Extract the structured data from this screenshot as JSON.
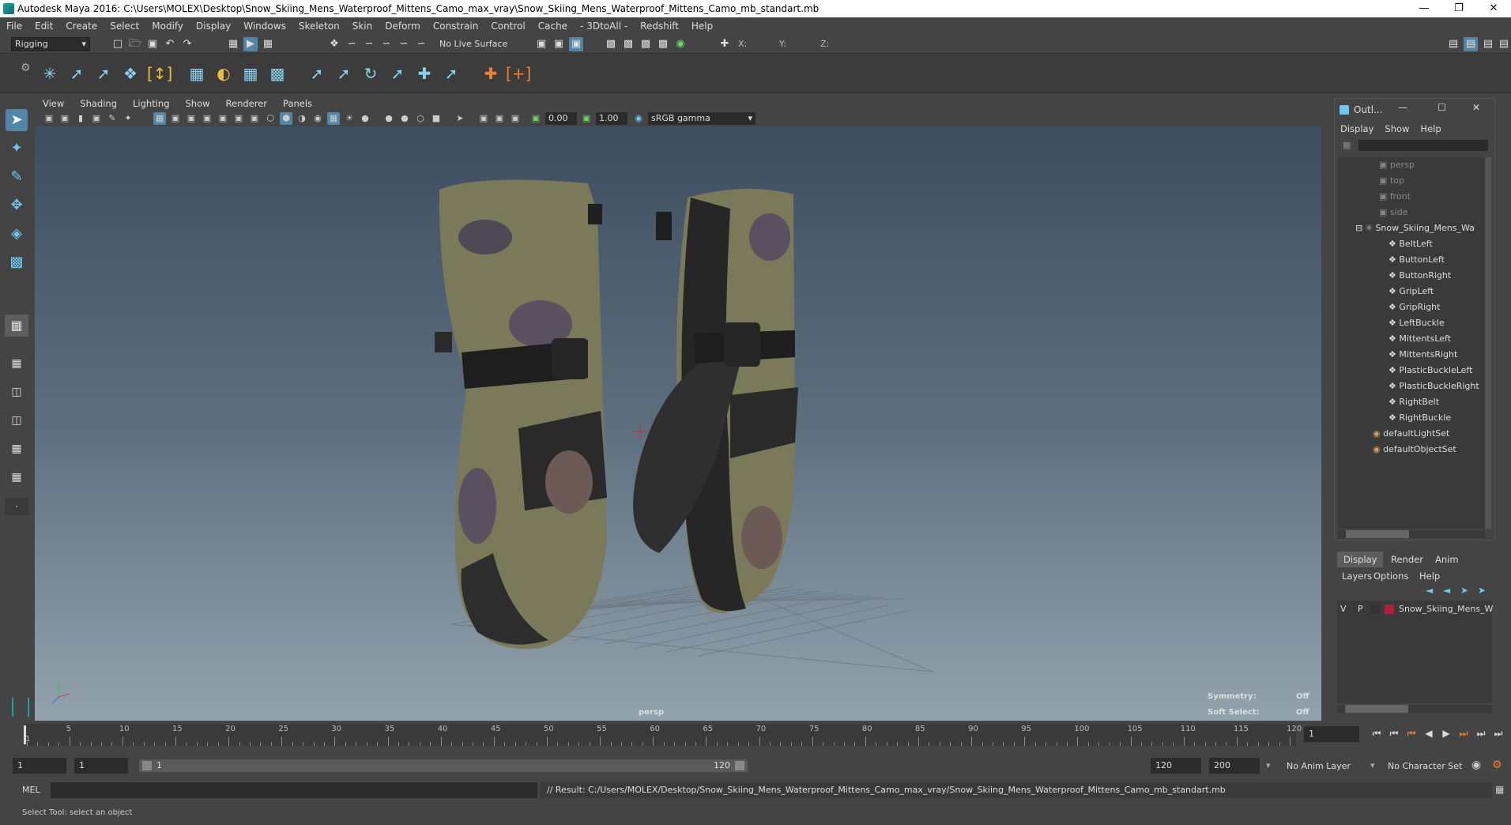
{
  "window": {
    "title": "Autodesk Maya 2016: C:\\Users\\MOLEX\\Desktop\\Snow_Skiing_Mens_Waterproof_Mittens_Camo_max_vray\\Snow_Skiing_Mens_Waterproof_Mittens_Camo_mb_standart.mb"
  },
  "menubar": [
    "File",
    "Edit",
    "Create",
    "Select",
    "Modify",
    "Display",
    "Windows",
    "Skeleton",
    "Skin",
    "Deform",
    "Constrain",
    "Control",
    "Cache",
    "- 3DtoAll -",
    "Redshift",
    "Help"
  ],
  "status": {
    "menuset": "Rigging",
    "live_surface": "No Live Surface",
    "x_label": "X:",
    "y_label": "Y:",
    "z_label": "Z:"
  },
  "viewport": {
    "menu": [
      "View",
      "Shading",
      "Lighting",
      "Show",
      "Renderer",
      "Panels"
    ],
    "exposure": "0.00",
    "gamma": "1.00",
    "colorspace": "sRGB gamma",
    "camera": "persp",
    "hud": {
      "symmetry_label": "Symmetry:",
      "symmetry_value": "Off",
      "soft_label": "Soft Select:",
      "soft_value": "Off"
    }
  },
  "outliner": {
    "title": "Outl...",
    "menu": [
      "Display",
      "Show",
      "Help"
    ],
    "cameras": [
      "persp",
      "top",
      "front",
      "side"
    ],
    "group": "Snow_Skiing_Mens_Wa",
    "children": [
      "BeltLeft",
      "ButtonLeft",
      "ButtonRight",
      "GripLeft",
      "GripRight",
      "LeftBuckle",
      "MittentsLeft",
      "MittentsRight",
      "PlasticBuckleLeft",
      "PlasticBuckleRight",
      "RightBelt",
      "RightBuckle"
    ],
    "sets": [
      "defaultLightSet",
      "defaultObjectSet"
    ]
  },
  "layers": {
    "tabs": [
      "Display",
      "Render",
      "Anim"
    ],
    "menu": [
      "Layers",
      "Options",
      "Help"
    ],
    "row": {
      "v": "V",
      "p": "P",
      "name": "Snow_Skiing_Mens_W"
    }
  },
  "timeline": {
    "ticks": [
      "5",
      "10",
      "15",
      "20",
      "25",
      "30",
      "35",
      "40",
      "45",
      "50",
      "55",
      "60",
      "65",
      "70",
      "75",
      "80",
      "85",
      "90",
      "95",
      "100",
      "105",
      "110",
      "115",
      "120"
    ],
    "start_tick": "1",
    "current_frame": "1"
  },
  "range": {
    "start": "1",
    "anim_start": "1",
    "slider_start": "1",
    "slider_end": "120",
    "end": "120",
    "anim_end": "200",
    "anim_layer": "No Anim Layer",
    "char_set": "No Character Set"
  },
  "cmd": {
    "lang": "MEL",
    "result": "// Result: C:/Users/MOLEX/Desktop/Snow_Skiing_Mens_Waterproof_Mittens_Camo_max_vray/Snow_Skiing_Mens_Waterproof_Mittens_Camo_mb_standart.mb"
  },
  "help": "Select Tool: select an object"
}
